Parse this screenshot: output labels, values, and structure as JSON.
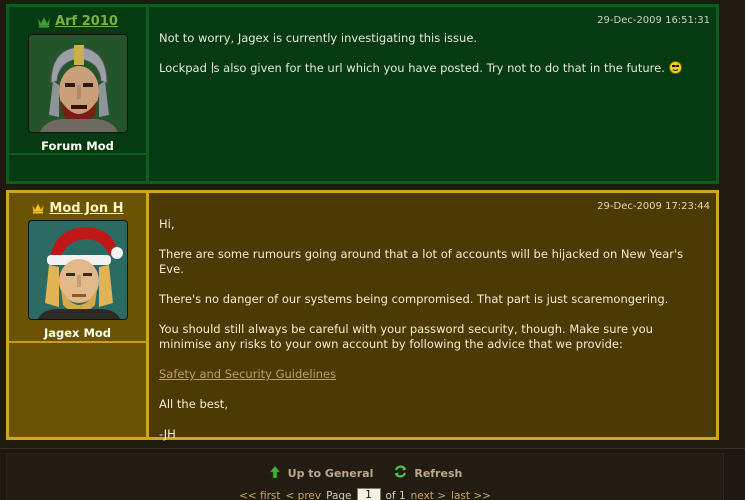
{
  "posts": [
    {
      "author": "Arf 2010",
      "role": "Forum Mod",
      "date": "29-Dec-2009 16:51:31",
      "line1": "Not to worry, Jagex is currently investigating this issue.",
      "line2_a": "Lockpad ",
      "line2_b": "s also given for the url which you have posted. Try not to do that in the future.",
      "crown_color": "#3fa33a",
      "icons": [
        "crown-icon",
        "smiley-icon"
      ]
    },
    {
      "author": "Mod Jon H",
      "role": "Jagex Mod",
      "date": "29-Dec-2009 17:23:44",
      "greeting": "Hi,",
      "p1": "There are some rumours going around that a lot of accounts will be hijacked on New Year's Eve.",
      "p2": "There's no danger of our systems being compromised. That part is just scaremongering.",
      "p3": "You should still always be careful with your password security, though. Make sure you minimise any risks to your own account by following the advice that we provide:",
      "link": "Safety and Security Guidelines",
      "closing": "All the best,",
      "signature": "-JH",
      "crown_color": "#f2c21a",
      "icons": [
        "crown-icon"
      ]
    }
  ],
  "footer": {
    "up_label": "Up to General",
    "refresh_label": "Refresh",
    "first": "<< first",
    "prev": "< prev",
    "page_label": "Page",
    "page_value": "1",
    "of_label": "of 1",
    "next": "next >",
    "last": "last >>",
    "icons": [
      "up-arrow-icon",
      "refresh-icon"
    ]
  },
  "colors": {
    "mod_green": "#063a12",
    "jagex_gold": "#4b3a04",
    "link": "#bf9f63"
  }
}
